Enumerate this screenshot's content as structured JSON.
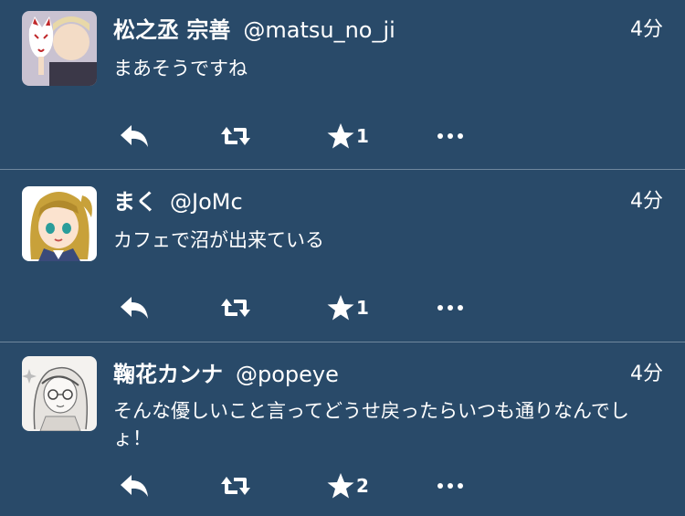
{
  "tweets": [
    {
      "name": "松之丞 宗善",
      "handle": "@matsu_no_ji",
      "time": "4分",
      "text": "まあそうですね",
      "favorites": "1",
      "avatar_icon": "avatar-fox-mask-icon"
    },
    {
      "name": "まく",
      "handle": "@JoMc",
      "time": "4分",
      "text": "カフェで沼が出来ている",
      "favorites": "1",
      "avatar_icon": "avatar-anime-girl-icon"
    },
    {
      "name": "鞠花カンナ",
      "handle": "@popeye",
      "time": "4分",
      "text": "そんな優しいこと言ってどうせ戻ったらいつも通りなんでしょ！",
      "favorites": "2",
      "avatar_icon": "avatar-sketch-icon"
    }
  ],
  "colors": {
    "background": "#294a69",
    "divider": "#6f879d",
    "text": "#ffffff"
  }
}
